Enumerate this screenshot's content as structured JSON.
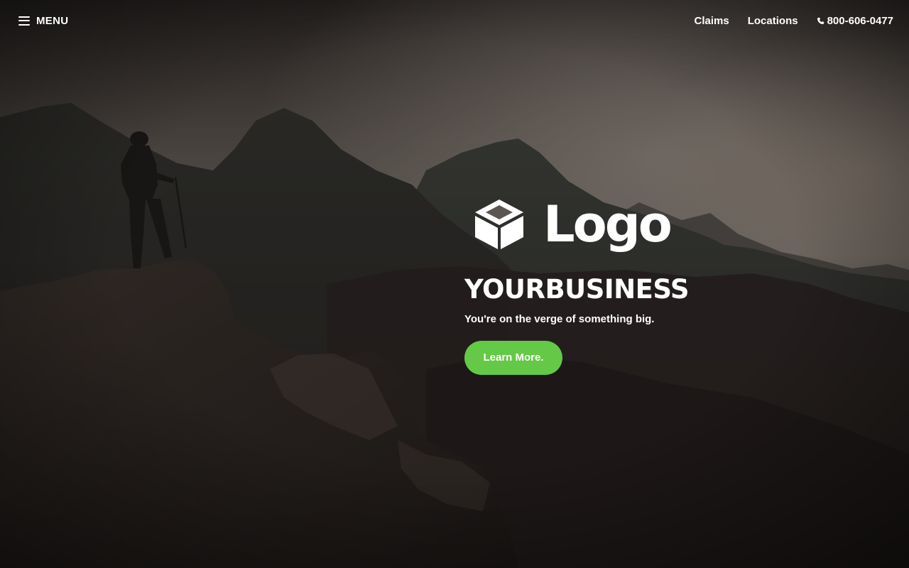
{
  "header": {
    "menu_label": "MENU",
    "nav_items": [
      {
        "label": "Claims"
      },
      {
        "label": "Locations"
      }
    ],
    "phone": "800-606-0477",
    "phone_icon": "phone-icon",
    "menu_icon": "hamburger-menu-icon"
  },
  "hero": {
    "logo_text": "Logo",
    "logo_icon": "box-icon",
    "business_name": "YOURBUSINESS",
    "tagline": "You're on the verge of something big.",
    "cta_label": "Learn More."
  },
  "colors": {
    "accent": "#64c946",
    "text": "#ffffff",
    "overlay": "#1c1a1a"
  }
}
